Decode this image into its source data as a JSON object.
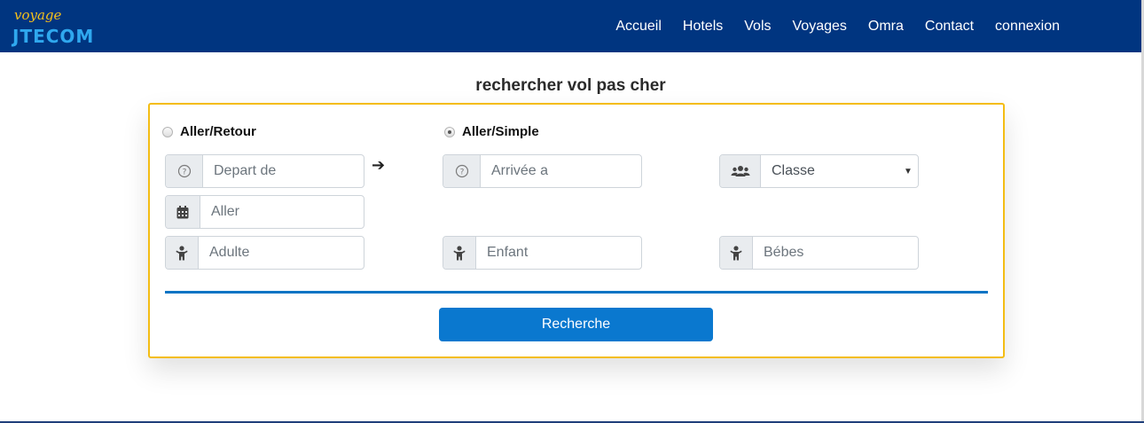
{
  "logo": {
    "script_text": "voyage",
    "brand_text": "JTECOM"
  },
  "nav": {
    "links": [
      "Accueil",
      "Hotels",
      "Vols",
      "Voyages",
      "Omra",
      "Contact",
      "connexion"
    ]
  },
  "page": {
    "title": "rechercher vol pas cher"
  },
  "form": {
    "trip_type": {
      "round_trip_label": "Aller/Retour",
      "one_way_label": "Aller/Simple",
      "selected": "Aller/Simple"
    },
    "departure": {
      "placeholder": "Depart de",
      "icon": "question-circle-icon"
    },
    "arrival": {
      "placeholder": "Arrivée a",
      "icon": "question-circle-icon"
    },
    "class_select": {
      "value": "Classe",
      "icon": "users-icon"
    },
    "date_out": {
      "placeholder": "Aller",
      "icon": "calendar-icon"
    },
    "adults": {
      "placeholder": "Adulte",
      "icon": "child-icon"
    },
    "children": {
      "placeholder": "Enfant",
      "icon": "child-icon"
    },
    "babies": {
      "placeholder": "Bébes",
      "icon": "child-icon"
    },
    "submit_label": "Recherche"
  },
  "colors": {
    "navbar": "#003580",
    "card_border": "#f4bd14",
    "divider": "#0d74c4",
    "button": "#0a78cf"
  }
}
